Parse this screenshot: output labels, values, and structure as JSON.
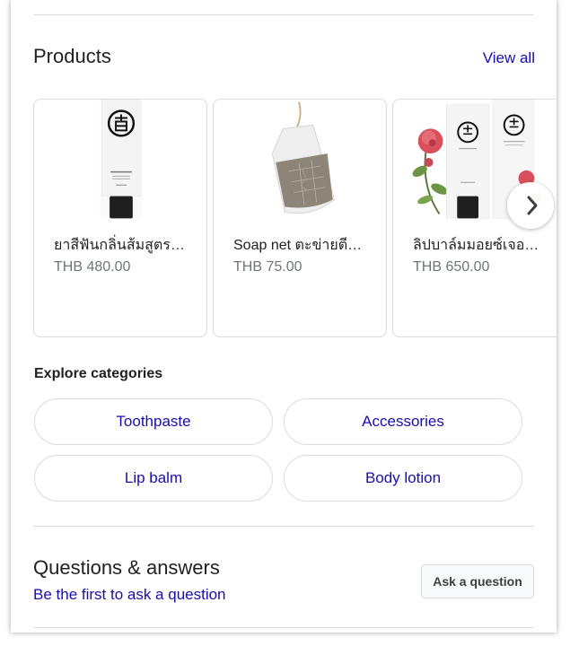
{
  "products": {
    "title": "Products",
    "view_all": "View all",
    "items": [
      {
        "name": "ยาสีฟันกลิ่นส้มสูตร…",
        "price": "THB 480.00",
        "image": "toothpaste-tube"
      },
      {
        "name": "Soap net ตะข่ายตี…",
        "price": "THB 75.00",
        "image": "soap-net"
      },
      {
        "name": "ลิปบาล์มมอยซ์เจอ…",
        "price": "THB 650.00",
        "image": "lip-balm-with-rose"
      }
    ],
    "next_icon": "chevron-right-icon"
  },
  "categories": {
    "heading": "Explore categories",
    "items": [
      "Toothpaste",
      "Accessories",
      "Lip balm",
      "Body lotion"
    ]
  },
  "qa": {
    "title": "Questions & answers",
    "link": "Be the first to ask a question",
    "ask_button": "Ask a question"
  },
  "colors": {
    "link": "#1a0dab",
    "text": "#202124",
    "muted": "#70757a",
    "border": "#dadce0"
  }
}
